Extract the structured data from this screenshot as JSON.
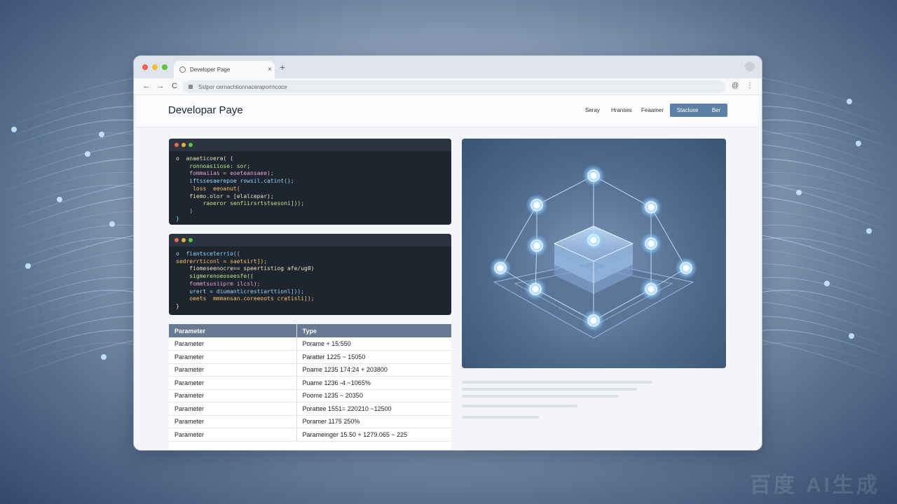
{
  "tab": {
    "title": "Developer Page",
    "close": "×",
    "new_tab": "+"
  },
  "toolbar": {
    "back": "←",
    "forward": "→",
    "reload": "C",
    "url": "Sstpor cernachtionnaceraporrncoce",
    "account": "@",
    "menu": "⋮"
  },
  "site": {
    "title": "Developar Paye",
    "nav": [
      "Seray",
      "Hranses",
      "Feaamer"
    ],
    "cta": [
      "Stacluse",
      "Ber"
    ]
  },
  "code_blocks": [
    {
      "lines": [
        "o  anaeticoera( (",
        "    ronnoasiiose: sor;",
        "    fommaiias = eoeteansaee);",
        "    iftssesaerepoe rowsil.catint();",
        "     loss  eeoanut(",
        "    fiemo.olor = [elalcepar);",
        "        raoeror senfiirsrtstsesoni]));",
        "    )",
        "}"
      ]
    },
    {
      "lines": [
        "o  fiantsceterrio((",
        "sedrerrticonl = saetsirt]);",
        "    fiomeseenocre== speertistiog afe/ug0)",
        "    sigmerenoeoseesfe((",
        "    fommtsusiiprm ilcsl);",
        "    urert = diumanticrestiarttionl]));",
        "    oeets  mmmansan.coreeoots cratisli]);",
        "}"
      ]
    }
  ],
  "table": {
    "headers": [
      "Parameter",
      "Type"
    ],
    "rows": [
      [
        "Parameter",
        "Porame + 15:550"
      ],
      [
        "Parameter",
        "Paratter 1225 ~ 15050"
      ],
      [
        "Parameter",
        "Poame 1235 174:24 + 203800"
      ],
      [
        "Parameter",
        "Puame 1236 -4 ~1065%"
      ],
      [
        "Parameter",
        "Poome 1235 ~ 20350"
      ],
      [
        "Parameter",
        "Porattee 1551= 220210 ~12500"
      ],
      [
        "Parameter",
        "Poramer 1175 250%"
      ],
      [
        "Parameter",
        "Parameinger 15.50 + 1279.065 ~ 225"
      ]
    ]
  },
  "colors": {
    "accent": "#5d7fa3",
    "table_header": "#687a92",
    "code_bg": "#1f252e"
  },
  "icons": [
    "globe-icon",
    "back-icon",
    "forward-icon",
    "reload-icon",
    "lock-icon",
    "account-icon",
    "menu-icon"
  ],
  "watermark": "百度 AI生成"
}
